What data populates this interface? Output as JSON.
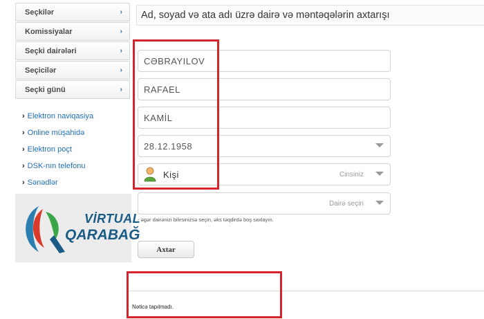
{
  "sidebar": {
    "menu": [
      {
        "label": "Seçkilər"
      },
      {
        "label": "Komissiyalar"
      },
      {
        "label": "Seçki dairələri"
      },
      {
        "label": "Seçicilər"
      },
      {
        "label": "Seçki günü"
      }
    ],
    "links": [
      {
        "label": "Elektron naviqasiya"
      },
      {
        "label": "Online müşahidə"
      },
      {
        "label": "Elektron poçt"
      },
      {
        "label": "DSK-nın telefonu"
      },
      {
        "label": "Sənədlər"
      }
    ],
    "logo": {
      "line1": "VİRTUAL",
      "line2": "QARABAĞ"
    }
  },
  "main": {
    "title": "Ad, soyad və ata adı üzrə dairə və məntəqələrin axtarışı",
    "surname": "CƏBRAYILOV",
    "name": "RAFAEL",
    "patronymic": "KAMİL",
    "birth_date": "28.12.1958",
    "gender": {
      "value": "Kişi",
      "placeholder": "Cinsiniz"
    },
    "district": {
      "placeholder": "Dairə seçin"
    },
    "note": "- əgər dairənizi bilirsinizsə seçin, əks təqdirdə boş saxlayın.",
    "search_label": "Axtar",
    "result": "Nəticə tapılmadı."
  },
  "colors": {
    "highlight": "#d6242c",
    "link": "#1f6eb3",
    "logo": "#1a5b85"
  }
}
